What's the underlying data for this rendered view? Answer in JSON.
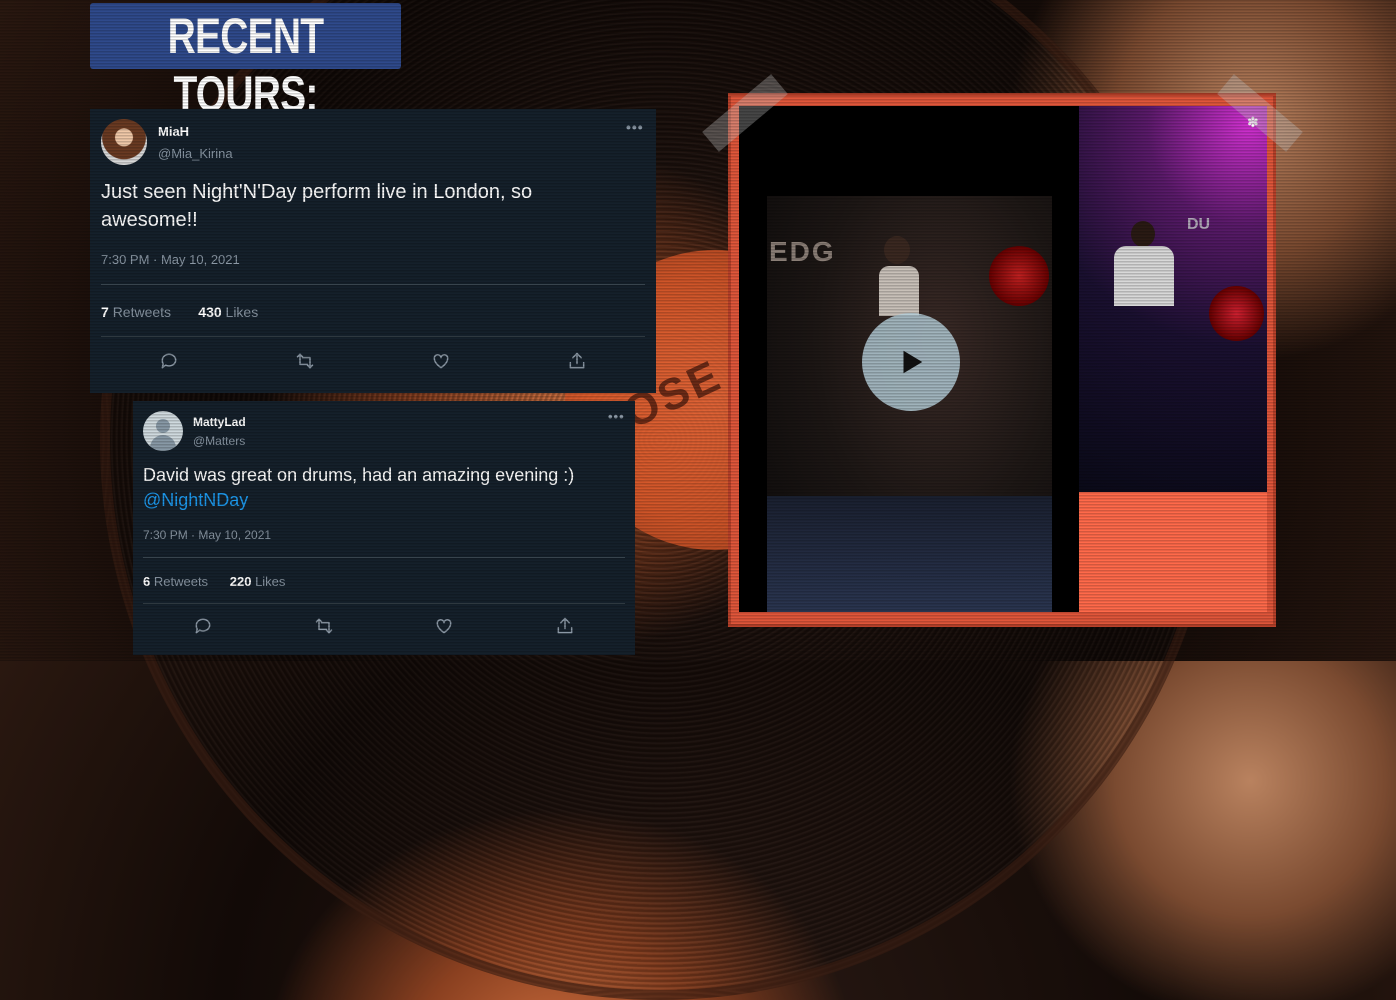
{
  "page": {
    "title": "RECENT TOURS:",
    "background_label_text": "OSE←"
  },
  "tweets": [
    {
      "name": "MiaH",
      "handle": "@Mia_Kirina",
      "text": "Just seen Night'N'Day perform live in London, so awesome!!",
      "mention": "",
      "timestamp": "7:30 PM · May 10, 2021",
      "retweets": "7",
      "retweets_label": "Retweets",
      "likes": "430",
      "likes_label": "Likes"
    },
    {
      "name": "MattyLad",
      "handle": "@Matters",
      "text": "David was great on drums, had an amazing evening :)",
      "mention": "@NightNDay",
      "timestamp": "7:30 PM · May 10, 2021",
      "retweets": "6",
      "retweets_label": "Retweets",
      "likes": "220",
      "likes_label": "Likes"
    }
  ],
  "video": {
    "stage_text_left": "EDG",
    "stage_text_right": "DU"
  },
  "icons": {
    "more": "more-options-icon",
    "reply": "reply-icon",
    "retweet": "retweet-icon",
    "like": "like-icon",
    "share": "share-icon",
    "play": "play-icon"
  },
  "colors": {
    "title_banner": "#2f4a8c",
    "tweet_bg": "#15202b",
    "mention": "#1d9bf0",
    "video_frame": "#e0563a",
    "video_fill": "#ff6a4a"
  }
}
